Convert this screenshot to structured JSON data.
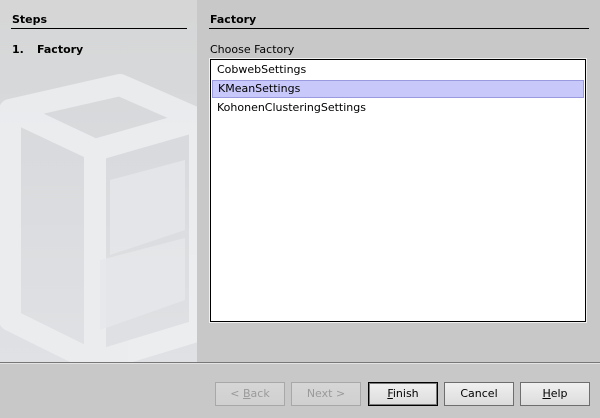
{
  "steps": {
    "title": "Steps",
    "items": [
      {
        "number": "1.",
        "label": "Factory"
      }
    ]
  },
  "content": {
    "title": "Factory",
    "choose_label": "Choose Factory",
    "factories": [
      {
        "label": "CobwebSettings",
        "selected": false
      },
      {
        "label": "KMeanSettings",
        "selected": true
      },
      {
        "label": "KohonenClusteringSettings",
        "selected": false
      }
    ]
  },
  "buttons": {
    "back_prefix": "< ",
    "back_mnemonic": "B",
    "back_rest": "ack",
    "next": "Next >",
    "finish_mnemonic": "F",
    "finish_rest": "inish",
    "cancel": "Cancel",
    "help_mnemonic": "H",
    "help_rest": "elp"
  },
  "colors": {
    "panel_bg": "#c8c8c8",
    "selection_bg": "#c8c8fa",
    "list_bg": "#ffffff"
  }
}
